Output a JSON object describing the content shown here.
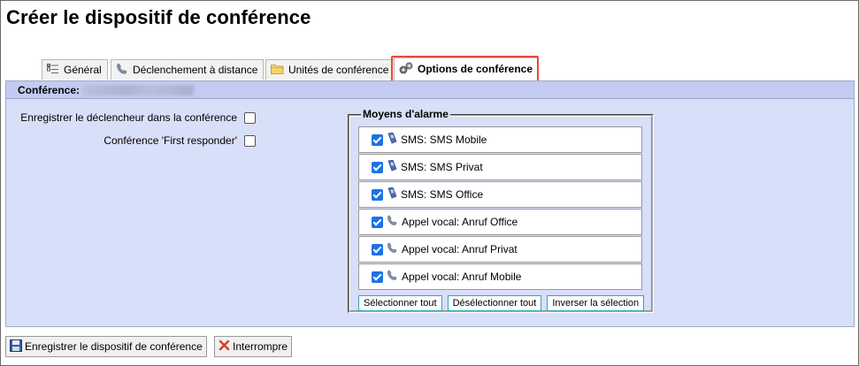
{
  "page_title": "Créer le dispositif de conférence",
  "tabs": [
    {
      "label": "Général",
      "icon": "checklist-icon",
      "active": false
    },
    {
      "label": "Déclenchement à distance",
      "icon": "phone-icon",
      "active": false
    },
    {
      "label": "Unités de conférence",
      "icon": "folder-icon",
      "active": false
    },
    {
      "label": "Options de conférence",
      "icon": "settings-icon",
      "active": true
    }
  ],
  "panel": {
    "conference_label": "Conférence:",
    "options": [
      {
        "label": "Enregistrer le déclencheur dans la conférence",
        "checked": false
      },
      {
        "label": "Conférence 'First responder'",
        "checked": false
      }
    ]
  },
  "alarm": {
    "legend": "Moyens d'alarme",
    "items": [
      {
        "label": "SMS: SMS Mobile",
        "checked": true,
        "icon": "mobile-phone-icon"
      },
      {
        "label": "SMS: SMS Privat",
        "checked": true,
        "icon": "mobile-phone-icon"
      },
      {
        "label": "SMS: SMS Office",
        "checked": true,
        "icon": "mobile-phone-icon"
      },
      {
        "label": "Appel vocal: Anruf Office",
        "checked": true,
        "icon": "phone-handset-icon"
      },
      {
        "label": "Appel vocal: Anruf Privat",
        "checked": true,
        "icon": "phone-handset-icon"
      },
      {
        "label": "Appel vocal: Anruf Mobile",
        "checked": true,
        "icon": "phone-handset-icon"
      }
    ],
    "select_all": "Sélectionner tout",
    "deselect_all": "Désélectionner tout",
    "invert": "Inverser la sélection"
  },
  "footer": {
    "save_label": "Enregistrer le dispositif de conférence",
    "cancel_label": "Interrompre"
  },
  "colors": {
    "panel_bg": "#d8dff8",
    "panel_header_bg": "#c2cbf2",
    "checkbox_checked": "#1a73e8",
    "highlight_border": "#e64a3b",
    "small_button_border": "#35a3b8"
  }
}
